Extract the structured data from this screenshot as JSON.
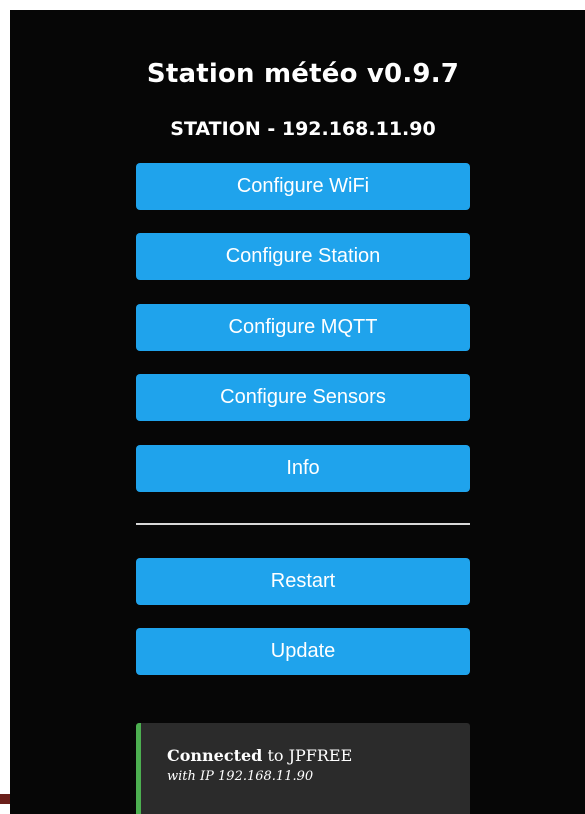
{
  "header": {
    "title": "Station météo v0.9.7",
    "subtitle": "STATION - 192.168.11.90"
  },
  "menu": {
    "configure_wifi": "Configure WiFi",
    "configure_station": "Configure Station",
    "configure_mqtt": "Configure MQTT",
    "configure_sensors": "Configure Sensors",
    "info": "Info",
    "restart": "Restart",
    "update": "Update"
  },
  "status": {
    "connected_label": "Connected",
    "connected_to": " to JPFREE",
    "ip_line": "with IP 192.168.11.90"
  },
  "colors": {
    "background": "#060606",
    "button": "#1fa3ec",
    "status_box": "#2b2b2b",
    "status_accent": "#4caf50",
    "divider": "#d8d8d8"
  }
}
